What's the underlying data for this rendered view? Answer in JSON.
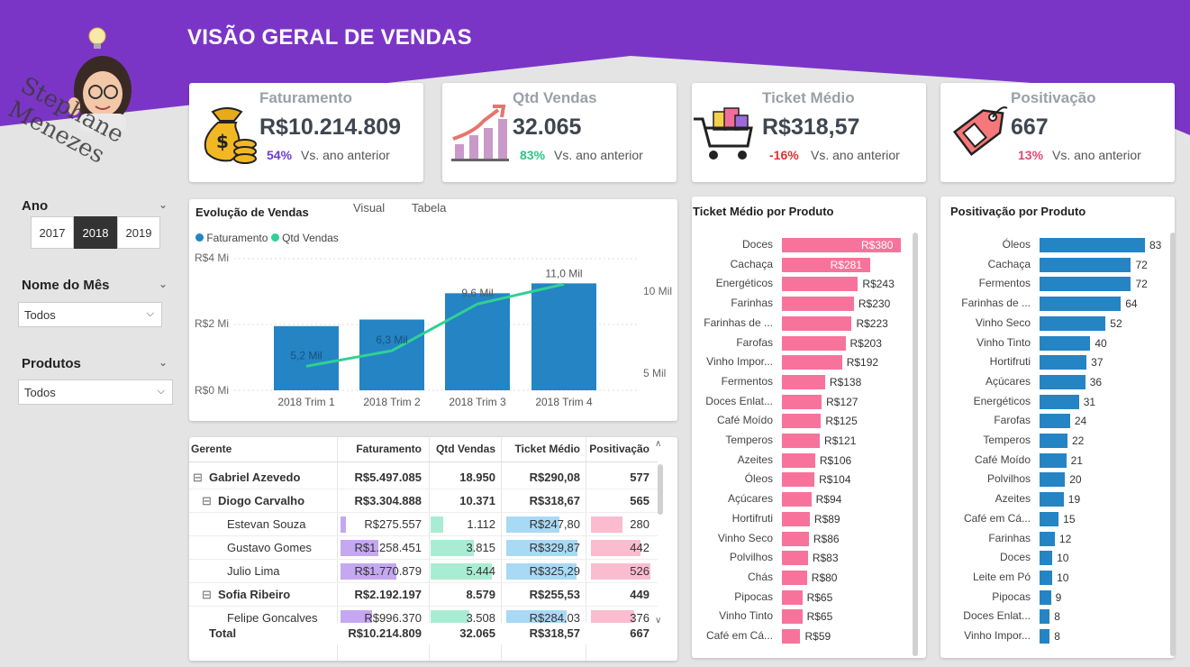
{
  "header": {
    "title": "VISÃO GERAL DE VENDAS",
    "signature": "Stephane Menezes",
    "purple": "#7b35c6"
  },
  "kpis": [
    {
      "label": "Faturamento",
      "value": "R$10.214.809",
      "delta": "54%",
      "delta_color": "#6a3fcf",
      "vs": "Vs. ano anterior",
      "icon": "money-bag-icon"
    },
    {
      "label": "Qtd Vendas",
      "value": "32.065",
      "delta": "83%",
      "delta_color": "#2fc486",
      "vs": "Vs. ano anterior",
      "icon": "growth-chart-icon"
    },
    {
      "label": "Ticket Médio",
      "value": "R$318,57",
      "delta": "-16%",
      "delta_color": "#e0302e",
      "vs": "Vs. ano anterior",
      "icon": "shopping-cart-icon"
    },
    {
      "label": "Positivação",
      "value": "667",
      "delta": "13%",
      "delta_color": "#e24a73",
      "vs": "Vs. ano anterior",
      "icon": "price-tag-icon"
    }
  ],
  "filters": {
    "ano": {
      "title": "Ano",
      "options": [
        "2017",
        "2018",
        "2019"
      ],
      "selected": "2018"
    },
    "mes": {
      "title": "Nome do Mês",
      "value": "Todos"
    },
    "produtos": {
      "title": "Produtos",
      "value": "Todos"
    }
  },
  "evolution": {
    "title": "Evolução de Vendas",
    "tabs": [
      "Visual",
      "Tabela"
    ],
    "legend": [
      "Faturamento",
      "Qtd Vendas"
    ],
    "left_ticks": [
      "R$4 Mi",
      "R$2 Mi",
      "R$0 Mi"
    ],
    "right_ticks": [
      "10 Mil",
      "5 Mil"
    ],
    "colors": {
      "bar": "#2584c4",
      "line": "#2fd195"
    }
  },
  "chart_data": [
    {
      "type": "bar",
      "title": "Evolução de Vendas",
      "categories": [
        "2018 Trim 1",
        "2018 Trim 2",
        "2018 Trim 3",
        "2018 Trim 4"
      ],
      "series": [
        {
          "name": "Faturamento",
          "values": [
            1950000,
            2150000,
            2950000,
            3250000
          ]
        },
        {
          "name": "Qtd Vendas",
          "values": [
            5200,
            6300,
            9600,
            11000
          ],
          "labels": [
            "5,2 Mil",
            "6,3 Mil",
            "9,6 Mil",
            "11,0 Mil"
          ]
        }
      ],
      "ylim": [
        0,
        4000000
      ],
      "ylim_right": [
        3500,
        12800
      ]
    },
    {
      "type": "bar",
      "title": "Ticket Médio por Produto",
      "categories": [
        "Doces",
        "Cachaça",
        "Energéticos",
        "Farinhas",
        "Farinhas de ...",
        "Farofas",
        "Vinho Impor...",
        "Fermentos",
        "Doces Enlat...",
        "Café Moído",
        "Temperos",
        "Azeites",
        "Óleos",
        "Açúcares",
        "Hortifruti",
        "Vinho Seco",
        "Polvilhos",
        "Chás",
        "Pipocas",
        "Vinho Tinto",
        "Café em Cá..."
      ],
      "values": [
        380,
        281,
        243,
        230,
        223,
        203,
        192,
        138,
        127,
        125,
        121,
        106,
        104,
        94,
        89,
        86,
        83,
        80,
        65,
        65,
        59
      ],
      "labels": [
        "R$380",
        "R$281",
        "R$243",
        "R$230",
        "R$223",
        "R$203",
        "R$192",
        "R$138",
        "R$127",
        "R$125",
        "R$121",
        "R$106",
        "R$104",
        "R$94",
        "R$89",
        "R$86",
        "R$83",
        "R$80",
        "R$65",
        "R$65",
        "R$59"
      ],
      "color": "#f7739c"
    },
    {
      "type": "bar",
      "title": "Positivação por Produto",
      "categories": [
        "Óleos",
        "Cachaça",
        "Fermentos",
        "Farinhas de ...",
        "Vinho Seco",
        "Vinho Tinto",
        "Hortifruti",
        "Açúcares",
        "Energéticos",
        "Farofas",
        "Temperos",
        "Café Moído",
        "Polvilhos",
        "Azeites",
        "Café em Cá...",
        "Farinhas",
        "Doces",
        "Leite em Pó",
        "Pipocas",
        "Doces Enlat...",
        "Vinho Impor..."
      ],
      "values": [
        83,
        72,
        72,
        64,
        52,
        40,
        37,
        36,
        31,
        24,
        22,
        21,
        20,
        19,
        15,
        12,
        10,
        10,
        9,
        8,
        8
      ],
      "color": "#2584c4"
    }
  ],
  "table": {
    "headers": [
      "Gerente",
      "Faturamento",
      "Qtd Vendas",
      "Ticket Médio",
      "Positivação"
    ],
    "rows": [
      {
        "name": "Gabriel Azevedo",
        "level": 0,
        "bold": true,
        "expander": "⊟",
        "fat": "R$5.497.085",
        "qtd": "18.950",
        "ticket": "R$290,08",
        "pos": "577"
      },
      {
        "name": "Diogo Carvalho",
        "level": 1,
        "bold": true,
        "expander": "⊟",
        "fat": "R$3.304.888",
        "qtd": "10.371",
        "ticket": "R$318,67",
        "pos": "565"
      },
      {
        "name": "Estevan Souza",
        "level": 2,
        "bold": false,
        "fat": "R$275.557",
        "qtd": "1.112",
        "ticket": "R$247,80",
        "pos": "280",
        "bars": [
          0.06,
          0.19,
          0.72,
          0.53
        ]
      },
      {
        "name": "Gustavo Gomes",
        "level": 2,
        "bold": false,
        "fat": "R$1.258.451",
        "qtd": "3.815",
        "ticket": "R$329,87",
        "pos": "442",
        "bars": [
          0.46,
          0.66,
          0.96,
          0.84
        ]
      },
      {
        "name": "Julio Lima",
        "level": 2,
        "bold": false,
        "fat": "R$1.770.879",
        "qtd": "5.444",
        "ticket": "R$325,29",
        "pos": "526",
        "bars": [
          0.67,
          0.94,
          0.95,
          1.0
        ]
      },
      {
        "name": "Sofia Ribeiro",
        "level": 1,
        "bold": true,
        "expander": "⊟",
        "fat": "R$2.192.197",
        "qtd": "8.579",
        "ticket": "R$255,53",
        "pos": "449"
      },
      {
        "name": "Felipe Goncalves",
        "level": 2,
        "bold": false,
        "fat": "R$996.370",
        "qtd": "3.508",
        "ticket": "R$284,03",
        "pos": "376",
        "bars": [
          0.38,
          0.6,
          0.82,
          0.72
        ]
      }
    ],
    "total": {
      "label": "Total",
      "fat": "R$10.214.809",
      "qtd": "32.065",
      "ticket": "R$318,57",
      "pos": "667"
    },
    "bar_colors": [
      "#c5a8f0",
      "#a8edd3",
      "#a8d9f5",
      "#fbbcd0"
    ]
  }
}
